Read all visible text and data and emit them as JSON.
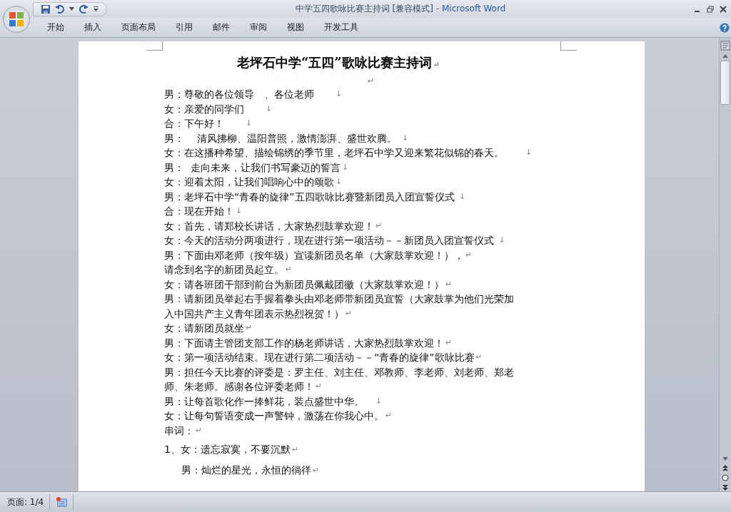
{
  "window": {
    "title": "中学五四歌咏比赛主持词 [兼容模式]",
    "app": "- Microsoft Word"
  },
  "tabs": [
    {
      "label": "开始",
      "selected": false
    },
    {
      "label": "插入",
      "selected": false
    },
    {
      "label": "页面布局",
      "selected": false
    },
    {
      "label": "引用",
      "selected": false
    },
    {
      "label": "邮件",
      "selected": false
    },
    {
      "label": "审阅",
      "selected": false
    },
    {
      "label": "视图",
      "selected": false
    },
    {
      "label": "开发工具",
      "selected": false
    }
  ],
  "document": {
    "title": "老坪石中学“五四”歌咏比赛主持词",
    "title_mark": "↵",
    "blank_mark": "↵",
    "lines": [
      {
        "text": "男：尊敬的各位领导　、各位老师　　",
        "mark": "↓"
      },
      {
        "text": "女：亲爱的同学们　　",
        "mark": "↓"
      },
      {
        "text": "合：下午好！　　",
        "mark": "↓"
      },
      {
        "text": "男：　 清风拂柳、温阳普照，激情澎湃、盛世欢腾。 ",
        "mark": "↓"
      },
      {
        "text": "女：在这播种希望、描绘锦绣的季节里，老坪石中学又迎来繁花似锦的春天。　　",
        "mark": "↓"
      },
      {
        "text": "男：  走向未来，让我们书写豪迈的誓言",
        "mark": "↓"
      },
      {
        "text": "女：迎着太阳，让我们唱响心中的颂歌",
        "mark": "↓"
      },
      {
        "text": "男：老坪石中学“青春的旋律”五四歌咏比赛暨新团员入团宣誓仪式 ",
        "mark": "↓"
      },
      {
        "text": "合：现在开始！",
        "mark": "↓"
      },
      {
        "text": "女；首先，请郑校长讲话，大家热烈鼓掌欢迎！",
        "mark": "↵"
      },
      {
        "text": "女：今天的活动分两项进行，现在进行第一项活动－－新团员入团宣誓仪式 ",
        "mark": "↓"
      },
      {
        "text": "男：下面由邓老师（按年级）宣读新团员名单（大家鼓掌欢迎！），",
        "mark": "↵"
      },
      {
        "text": "请念到名字的新团员起立。",
        "mark": "↵"
      },
      {
        "text": "女：请各班团干部到前台为新团员佩戴团徽（大家鼓掌欢迎！）",
        "mark": "↵"
      },
      {
        "text": "男：请新团员举起右手握着拳头由邓老师带新团员宣誓（大家鼓掌为他们光荣加"
      },
      {
        "text": "入中国共产主义青年团表示热烈祝贺！）",
        "mark": "↵"
      },
      {
        "text": "女：请新团员就坐",
        "mark": "↵"
      },
      {
        "text": "男：下面请主管团支部工作的杨老师讲话，大家热烈鼓掌欢迎！",
        "mark": "↵"
      },
      {
        "text": "女：第一项活动结束。现在进行第二项活动－－“青春的旋律”歌咏比赛",
        "mark": "↵"
      },
      {
        "text": "男：担任今天比赛的评委是：罗主任、刘主任、邓教师、李老师、刘老师、郑老"
      },
      {
        "text": "师、朱老师。感谢各位评委老师！",
        "mark": "↵"
      },
      {
        "text": "男：让每首歌化作一捧鲜花，装点盛世中华。　",
        "mark": "↓"
      },
      {
        "text": "女：让每句誓语变成一声警钟，激荡在你我心中。",
        "mark": "↵"
      },
      {
        "text": "串词：",
        "mark": "↵"
      }
    ],
    "verses": [
      {
        "text": "1、女：遗忘寂寞，不要沉默",
        "mark": "↵",
        "indent": false
      },
      {
        "text": "男：灿烂的星光，永恒的徜徉",
        "mark": "↵",
        "indent": true
      }
    ]
  },
  "status_bar": {
    "page": "页面: 1/4"
  }
}
